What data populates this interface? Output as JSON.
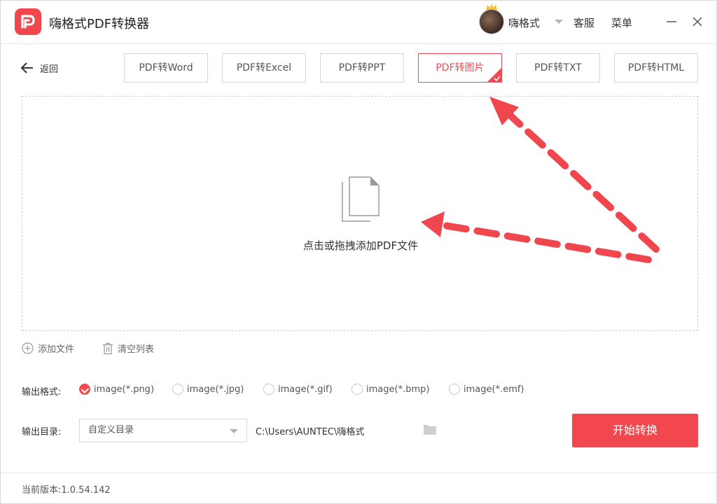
{
  "app": {
    "title": "嗨格式PDF转换器"
  },
  "user": {
    "name": "嗨格式"
  },
  "header": {
    "service": "客服",
    "menu": "菜单"
  },
  "nav": {
    "back": "返回"
  },
  "tabs": [
    {
      "label": "PDF转Word",
      "active": false
    },
    {
      "label": "PDF转Excel",
      "active": false
    },
    {
      "label": "PDF转PPT",
      "active": false
    },
    {
      "label": "PDF转图片",
      "active": true
    },
    {
      "label": "PDF转TXT",
      "active": false
    },
    {
      "label": "PDF转HTML",
      "active": false
    }
  ],
  "dropzone": {
    "text": "点击或拖拽添加PDF文件"
  },
  "actions": {
    "add_file": "添加文件",
    "clear_list": "清空列表"
  },
  "output_format": {
    "label": "输出格式:",
    "options": [
      {
        "label": "image(*.png)",
        "checked": true
      },
      {
        "label": "image(*.jpg)",
        "checked": false
      },
      {
        "label": "image(*.gif)",
        "checked": false
      },
      {
        "label": "image(*.bmp)",
        "checked": false
      },
      {
        "label": "image(*.emf)",
        "checked": false
      }
    ]
  },
  "output_dir": {
    "label": "输出目录:",
    "selected": "自定义目录",
    "path": "C:\\Users\\AUNTEC\\嗨格式"
  },
  "start_button": "开始转换",
  "footer": {
    "version": "当前版本:1.0.54.142"
  },
  "colors": {
    "accent": "#f04a4f",
    "annotation_arrow": "#f0474e"
  }
}
